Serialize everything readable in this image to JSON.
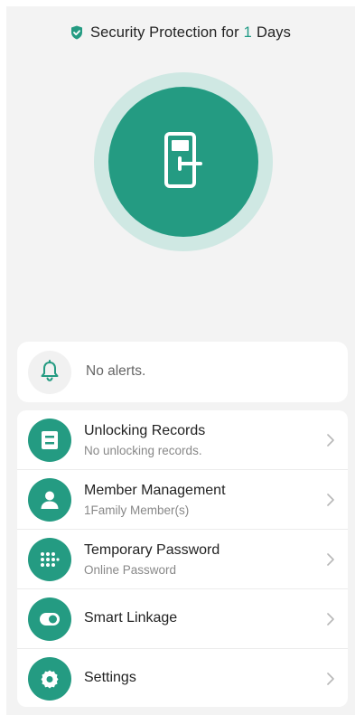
{
  "header": {
    "prefix": "Security Protection for",
    "days": "1",
    "suffix": "Days",
    "icon": "shield-check-icon"
  },
  "lock": {
    "icon": "door-lock-icon"
  },
  "alerts": {
    "text": "No alerts.",
    "icon": "bell-icon"
  },
  "menu": {
    "items": [
      {
        "title": "Unlocking Records",
        "subtitle": "No unlocking records.",
        "icon": "records-icon"
      },
      {
        "title": "Member Management",
        "subtitle": "1Family Member(s)",
        "icon": "member-icon"
      },
      {
        "title": "Temporary Password",
        "subtitle": "Online Password",
        "icon": "keypad-icon"
      },
      {
        "title": "Smart Linkage",
        "subtitle": "",
        "icon": "toggle-icon"
      },
      {
        "title": "Settings",
        "subtitle": "",
        "icon": "gear-icon"
      }
    ]
  },
  "colors": {
    "accent": "#249b82",
    "accent_light": "#cfe8e3",
    "background": "#f3f3f3"
  }
}
